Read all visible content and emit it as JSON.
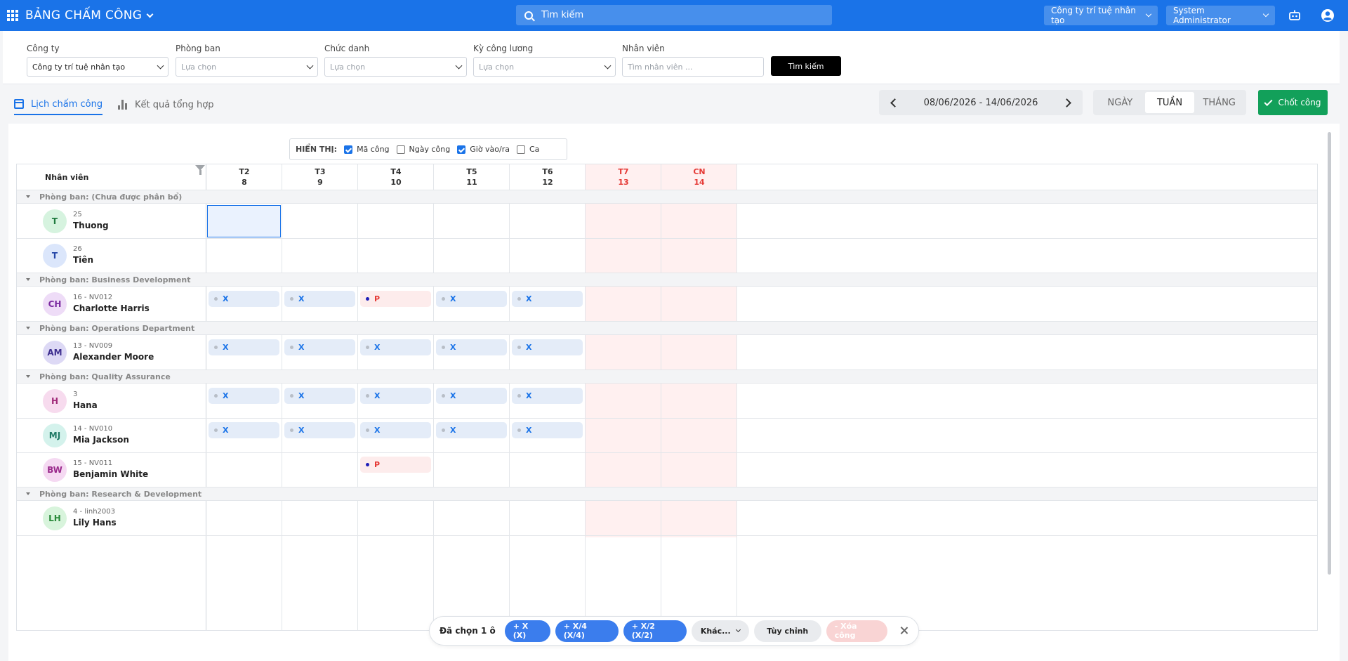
{
  "app": {
    "title": "BẢNG CHẤM CÔNG"
  },
  "search": {
    "placeholder": "Tìm kiếm"
  },
  "topbar": {
    "company": "Công ty trí tuệ nhân tạo",
    "user": "System Administrator"
  },
  "filters": {
    "company_label": "Công ty",
    "company_value": "Công ty trí tuệ nhân tạo",
    "department_label": "Phòng ban",
    "department_value": "Lựa chọn",
    "title_label": "Chức danh",
    "title_value": "Lựa chọn",
    "period_label": "Kỳ công lương",
    "period_value": "Lựa chọn",
    "employee_label": "Nhân viên",
    "employee_placeholder": "Tìm nhân viên ...",
    "search_button": "Tìm kiếm"
  },
  "tabs": {
    "calendar": "Lịch chấm công",
    "summary": "Kết quả tổng hợp"
  },
  "date_range": "08/06/2026 - 14/06/2026",
  "views": {
    "day": "NGÀY",
    "week": "TUẦN",
    "month": "THÁNG",
    "active": "week"
  },
  "lock_button": "Chốt công",
  "display": {
    "label": "HIỂN THỊ:",
    "options": [
      {
        "label": "Mã công",
        "checked": true
      },
      {
        "label": "Ngày công",
        "checked": false
      },
      {
        "label": "Giờ vào/ra",
        "checked": true
      },
      {
        "label": "Ca",
        "checked": false
      }
    ]
  },
  "grid": {
    "employee_header": "Nhân viên",
    "days": [
      {
        "dow": "T2",
        "date": "8",
        "weekend": false
      },
      {
        "dow": "T3",
        "date": "9",
        "weekend": false
      },
      {
        "dow": "T4",
        "date": "10",
        "weekend": false
      },
      {
        "dow": "T5",
        "date": "11",
        "weekend": false
      },
      {
        "dow": "T6",
        "date": "12",
        "weekend": false
      },
      {
        "dow": "T7",
        "date": "13",
        "weekend": true
      },
      {
        "dow": "CN",
        "date": "14",
        "weekend": true
      }
    ],
    "groups": [
      {
        "label": "Phòng ban: (Chưa được phân bổ)",
        "employees": [
          {
            "initials": "T",
            "code": "25",
            "name": "Thuong",
            "avatar_bg": "#d6f3df",
            "avatar_fg": "#1f7a3f",
            "cells": [
              null,
              null,
              null,
              null,
              null,
              null,
              null
            ]
          },
          {
            "initials": "T",
            "code": "26",
            "name": "Tiên",
            "avatar_bg": "#dbe6fb",
            "avatar_fg": "#2446a8",
            "cells": [
              null,
              null,
              null,
              null,
              null,
              null,
              null
            ]
          }
        ]
      },
      {
        "label": "Phòng ban: Business Development",
        "employees": [
          {
            "initials": "CH",
            "code": "16 - NV012",
            "name": "Charlotte Harris",
            "avatar_bg": "#eedcf7",
            "avatar_fg": "#7b2aa0",
            "cells": [
              "X",
              "X",
              "P",
              "X",
              "X",
              null,
              null
            ]
          }
        ]
      },
      {
        "label": "Phòng ban: Operations Department",
        "employees": [
          {
            "initials": "AM",
            "code": "13 - NV009",
            "name": "Alexander Moore",
            "avatar_bg": "#ddd9f5",
            "avatar_fg": "#3e2f8f",
            "cells": [
              "X",
              "X",
              "X",
              "X",
              "X",
              null,
              null
            ]
          }
        ]
      },
      {
        "label": "Phòng ban: Quality Assurance",
        "employees": [
          {
            "initials": "H",
            "code": "3",
            "name": "Hana",
            "avatar_bg": "#f7dbee",
            "avatar_fg": "#a02a78",
            "cells": [
              "X",
              "X",
              "X",
              "X",
              "X",
              null,
              null
            ]
          },
          {
            "initials": "MJ",
            "code": "14 - NV010",
            "name": "Mia Jackson",
            "avatar_bg": "#d4f2ec",
            "avatar_fg": "#1f7a66",
            "cells": [
              "X",
              "X",
              "X",
              "X",
              "X",
              null,
              null
            ]
          },
          {
            "initials": "BW",
            "code": "15 - NV011",
            "name": "Benjamin White",
            "avatar_bg": "#f5d9f2",
            "avatar_fg": "#9a2a8c",
            "cells": [
              null,
              null,
              "P",
              null,
              null,
              null,
              null
            ]
          }
        ]
      },
      {
        "label": "Phòng ban: Research & Development",
        "employees": [
          {
            "initials": "LH",
            "code": "4 - linh2003",
            "name": "Lily Hans",
            "avatar_bg": "#d8f4dc",
            "avatar_fg": "#2a8a3a",
            "cells": [
              null,
              null,
              null,
              null,
              null,
              null,
              null
            ]
          }
        ]
      }
    ]
  },
  "action_bar": {
    "selected": "Đã chọn 1 ô",
    "add_x": "+ X (X)",
    "add_x4": "+ X/4 (X/4)",
    "add_x2": "+ X/2 (X/2)",
    "other": "Khác...",
    "custom": "Tùy chỉnh",
    "delete": "- Xóa công"
  },
  "colors": {
    "primary": "#1a73e8",
    "success": "#12a05a",
    "weekend": "#e53935",
    "weekend_bg": "#fff0f0"
  }
}
